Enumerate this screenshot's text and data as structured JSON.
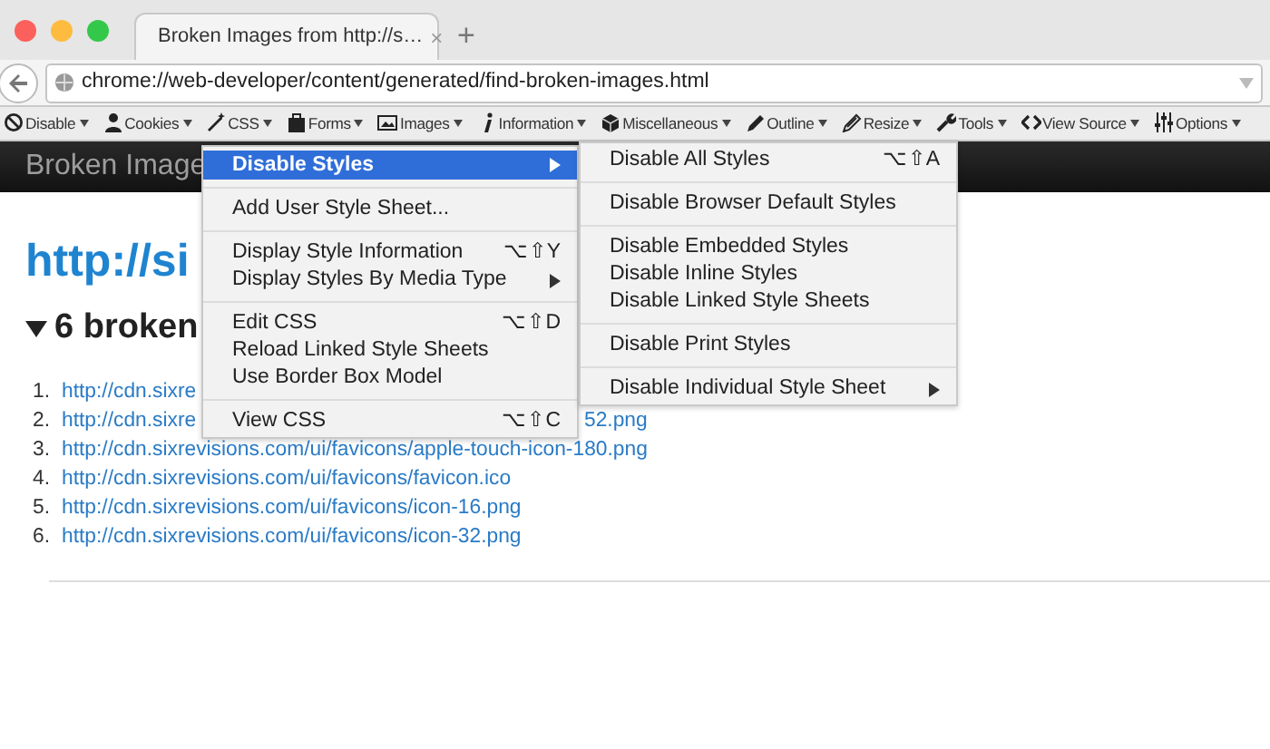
{
  "window": {
    "tab": {
      "title": "Broken Images from http://s…",
      "close": "×",
      "selected": true
    },
    "new_tab": "+"
  },
  "address_bar": {
    "url": "chrome://web-developer/content/generated/find-broken-images.html"
  },
  "toolbar": [
    {
      "label": "Disable"
    },
    {
      "label": "Cookies"
    },
    {
      "label": "CSS"
    },
    {
      "label": "Forms"
    },
    {
      "label": "Images"
    },
    {
      "label": "Information"
    },
    {
      "label": "Miscellaneous"
    },
    {
      "label": "Outline"
    },
    {
      "label": "Resize"
    },
    {
      "label": "Tools"
    },
    {
      "label": "View Source"
    },
    {
      "label": "Options"
    }
  ],
  "page": {
    "header": "Broken Image",
    "heading": "http://si",
    "subheading": "6 broken",
    "links": [
      {
        "number": "1.",
        "text": "http://cdn.sixre"
      },
      {
        "number": "2.",
        "text": "http://cdn.sixre",
        "tail": "52.png"
      },
      {
        "number": "3.",
        "text": "http://cdn.sixrevisions.com/ui/favicons/apple-touch-icon-180.png"
      },
      {
        "number": "4.",
        "text": "http://cdn.sixrevisions.com/ui/favicons/favicon.ico"
      },
      {
        "number": "5.",
        "text": "http://cdn.sixrevisions.com/ui/favicons/icon-16.png"
      },
      {
        "number": "6.",
        "text": "http://cdn.sixrevisions.com/ui/favicons/icon-32.png"
      }
    ]
  },
  "css_menu": {
    "groups": [
      [
        {
          "label": "Disable Styles",
          "submenu": true,
          "selected": true
        }
      ],
      [
        {
          "label": "Add User Style Sheet...",
          "submenu": false,
          "selected": false
        }
      ],
      [
        {
          "label": "Display Style Information",
          "shortcut": "⌥⇧Y",
          "submenu": false,
          "selected": false
        },
        {
          "label": "Display Styles By Media Type",
          "submenu": true,
          "selected": false
        }
      ],
      [
        {
          "label": "Edit CSS",
          "shortcut": "⌥⇧D",
          "submenu": false,
          "selected": false
        },
        {
          "label": "Reload Linked Style Sheets",
          "submenu": false,
          "selected": false
        },
        {
          "label": "Use Border Box Model",
          "submenu": false,
          "selected": false
        }
      ],
      [
        {
          "label": "View CSS",
          "shortcut": "⌥⇧C",
          "submenu": false,
          "selected": false
        }
      ]
    ]
  },
  "disable_styles_menu": {
    "groups": [
      [
        {
          "label": "Disable All Styles",
          "shortcut": "⌥⇧A",
          "submenu": false,
          "selected": false
        }
      ],
      [
        {
          "label": "Disable Browser Default Styles",
          "submenu": false,
          "selected": false
        }
      ],
      [
        {
          "label": "Disable Embedded Styles",
          "submenu": false,
          "selected": false
        },
        {
          "label": "Disable Inline Styles",
          "submenu": false,
          "selected": false
        },
        {
          "label": "Disable Linked Style Sheets",
          "submenu": false,
          "selected": false
        }
      ],
      [
        {
          "label": "Disable Print Styles",
          "submenu": false,
          "selected": false
        }
      ],
      [
        {
          "label": "Disable Individual Style Sheet",
          "submenu": true,
          "selected": false
        }
      ]
    ]
  }
}
